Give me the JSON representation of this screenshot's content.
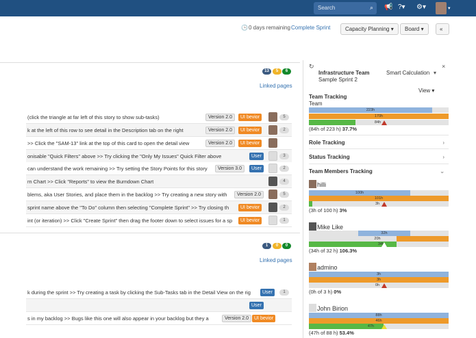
{
  "header": {
    "search_placeholder": "Search",
    "days_remaining": "0 days remaining",
    "complete_sprint": "Complete Sprint",
    "capacity_planning": "Capacity Planning",
    "board": "Board"
  },
  "sprint1": {
    "badges": [
      "13",
      "5",
      "6"
    ],
    "linked_pages": "Linked pages",
    "issues": [
      {
        "summary": "(click the triangle at far left of this story to show sub-tasks)",
        "version": "Version 2.0",
        "epic": "UI bevior",
        "estimate": "5"
      },
      {
        "summary": "k at the left of this row to see detail in the Description tab on the right",
        "version": "Version 2.0",
        "epic": "UI bevior",
        "estimate": "2"
      },
      {
        "summary": ">> Click the \"SAM-13\" link at the top of this card to open the detail view",
        "version": "Version 2.0",
        "epic": "UI bevior",
        "estimate": ""
      },
      {
        "summary": "onisable \"Quick Filters\" above >> Try clicking the \"Only My Issues\" Quick Filter above",
        "tag": "User",
        "estimate": "3"
      },
      {
        "summary": " can understand the work remaining >> Try setting the Story Points for this story",
        "version": "Version 3.0",
        "tag": "User",
        "estimate": "2"
      },
      {
        "summary": "rn Chart >> Click \"Reports\" to view the Burndown Chart",
        "estimate": "4"
      },
      {
        "summary": "blems, aka User Stories, and place them in the backlog >> Try creating a new story with",
        "version": "Version 2.0",
        "epic": "UI bevior",
        "estimate": "5"
      },
      {
        "summary": " sprint name above the \"To Do\" column then selecting \"Complete Sprint\" >> Try closing th",
        "epic": "UI bevior",
        "estimate": "2"
      },
      {
        "summary": "int (or iteration) >> Click \"Create Sprint\" then drag the footer down to select issues for a sp",
        "epic": "UI bevior",
        "estimate": "1"
      }
    ]
  },
  "sprint2": {
    "badges": [
      "1",
      "0",
      "0"
    ],
    "linked_pages": "Linked pages",
    "issues": [
      {
        "summary": "k during the sprint >> Try creating a task by clicking the Sub-Tasks tab in the Detail View on the rig",
        "tag": "User",
        "estimate": "1"
      },
      {
        "summary": "",
        "tag": "User",
        "estimate": ""
      },
      {
        "summary": "s in my backlog >> Bugs like this one will also appear in your backlog but they a",
        "version": "Version 2.0",
        "epic": "UI bevior",
        "estimate": ""
      }
    ]
  },
  "panel": {
    "team": "Infrastructure Team",
    "calc": "Smart Calculation",
    "sprint": "Sample Sprint 2",
    "view": "View",
    "team_tracking": "Team Tracking",
    "team_label": "Team",
    "team_bars": {
      "blue": "223h",
      "orange": "170h",
      "green": "84h"
    },
    "team_stat": "(84h of 223 h)",
    "team_pct": "37.7%",
    "role_tracking": "Role Tracking",
    "status_tracking": "Status Tracking",
    "members_tracking": "Team Members Tracking",
    "members": [
      {
        "name": "hilli",
        "blue": "100h",
        "orange": "101h",
        "green": "3h",
        "stat": "(3h of 100 h)",
        "pct": "3%"
      },
      {
        "name": "Mike Like",
        "blue": "32h",
        "orange": "20h",
        "green": "34h",
        "stat": "(34h of 32 h)",
        "pct": "106.3%"
      },
      {
        "name": "admino",
        "blue": "3h",
        "orange": "3h",
        "green": "0h",
        "stat": "(0h of 3 h)",
        "pct": "0%"
      },
      {
        "name": "John Birion",
        "blue": "88h",
        "orange": "46h",
        "green": "47h",
        "stat": "(47h of 88 h)",
        "pct": "53.4%"
      }
    ]
  },
  "colors": {
    "topbar": "#205081",
    "link": "#3572b0",
    "epic": "#f08a24",
    "blue_bar": "#8fb3dd",
    "orange_bar": "#ee9a2a",
    "green_bar": "#57b846"
  }
}
